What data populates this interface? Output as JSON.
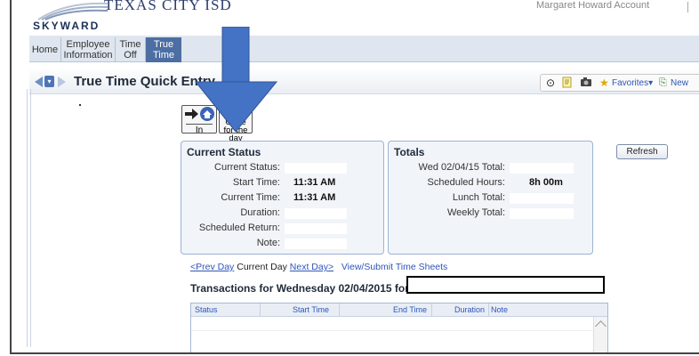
{
  "header": {
    "logo_text": "SKYWARD",
    "district": "TEXAS CITY ISD",
    "user_text": "Margaret Howard    Account"
  },
  "nav": {
    "tabs": [
      {
        "label": "Home"
      },
      {
        "label": "Employee Information"
      },
      {
        "label": "Time Off"
      },
      {
        "label": "True Time"
      }
    ]
  },
  "titlebar": {
    "title": "True Time Quick Entry",
    "toolbar": {
      "favorites": "Favorites",
      "new": "New"
    }
  },
  "actions": {
    "in_label": "In",
    "gone_label": "Gone for the day"
  },
  "current_status": {
    "title": "Current Status",
    "rows": [
      {
        "label": "Current Status:",
        "value": ""
      },
      {
        "label": "Start Time:",
        "value": "11:31 AM"
      },
      {
        "label": "Current Time:",
        "value": "11:31 AM"
      },
      {
        "label": "Duration:",
        "value": ""
      },
      {
        "label": "Scheduled Return:",
        "value": ""
      },
      {
        "label": "Note:",
        "value": ""
      }
    ]
  },
  "totals": {
    "title": "Totals",
    "rows": [
      {
        "label": "Wed 02/04/15 Total:",
        "value": ""
      },
      {
        "label": "Scheduled Hours:",
        "value": "8h 00m"
      },
      {
        "label": "Lunch Total:",
        "value": ""
      },
      {
        "label": "Weekly Total:",
        "value": ""
      }
    ]
  },
  "refresh_label": "Refresh",
  "day_links": {
    "prev": "<Prev Day",
    "current": "Current Day",
    "next": "Next Day>",
    "view": "View/Submit Time Sheets"
  },
  "transactions": {
    "title": "Transactions for Wednesday 02/04/2015 for",
    "columns": [
      "Status",
      "Start Time",
      "End Time",
      "Duration",
      "Note"
    ]
  }
}
